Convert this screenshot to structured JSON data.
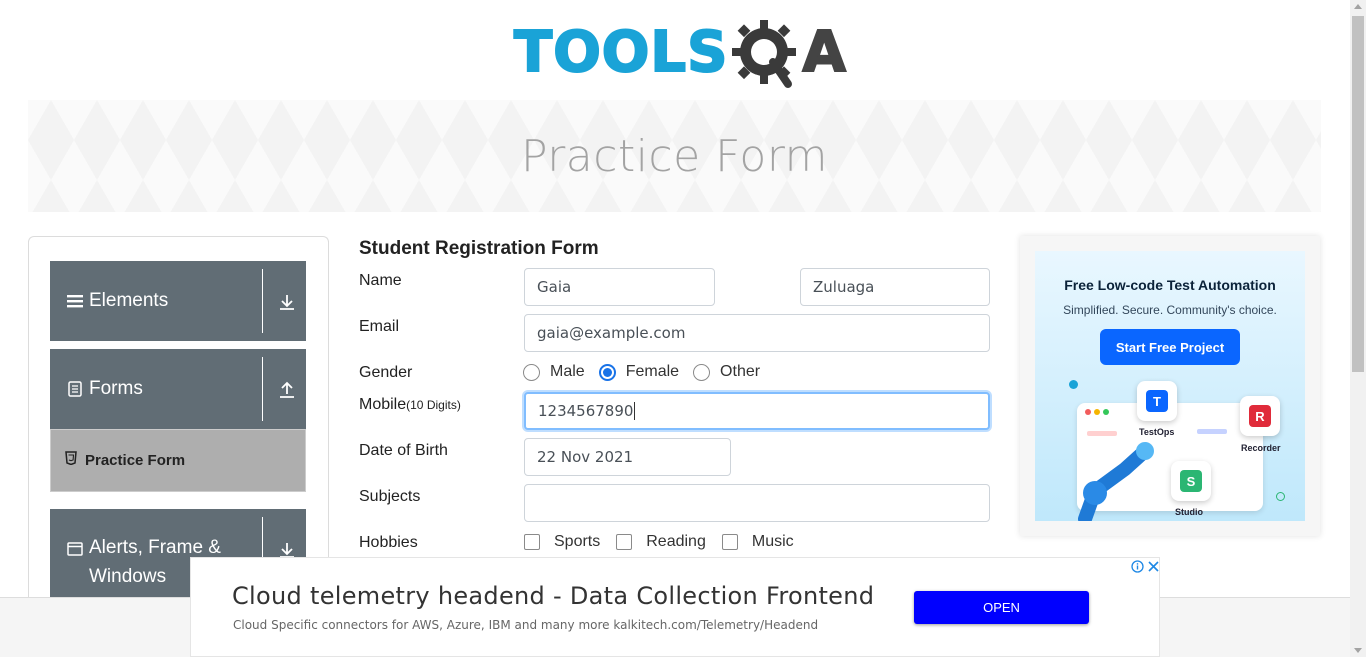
{
  "header": {
    "logo_tools": "TOOLS",
    "logo_a": "A",
    "logo_q": "Q"
  },
  "banner": {
    "title": "Practice Form"
  },
  "sidebar": {
    "groups": [
      {
        "label": "Elements",
        "icon": "hamburger-icon",
        "arrow": "download-arrow-icon"
      },
      {
        "label": "Forms",
        "icon": "document-icon",
        "arrow": "upload-arrow-icon",
        "items": [
          {
            "label": "Practice Form",
            "icon": "html5-icon"
          }
        ]
      },
      {
        "label": "Alerts, Frame & Windows",
        "icon": "window-icon",
        "arrow": "download-arrow-icon"
      }
    ]
  },
  "form": {
    "title": "Student Registration Form",
    "name_label": "Name",
    "first_name": "Gaia",
    "last_name": "Zuluaga",
    "email_label": "Email",
    "email_value": "gaia@example.com",
    "gender_label": "Gender",
    "gender_options": [
      "Male",
      "Female",
      "Other"
    ],
    "gender_selected": "Female",
    "mobile_label": "Mobile",
    "mobile_hint": "(10 Digits)",
    "mobile_value": "1234567890",
    "dob_label": "Date of Birth",
    "dob_value": "22 Nov 2021",
    "subjects_label": "Subjects",
    "hobbies_label": "Hobbies",
    "hobbies": [
      "Sports",
      "Reading",
      "Music"
    ]
  },
  "ad_right": {
    "headline": "Free Low-code Test Automation",
    "subline": "Simplified. Secure. Community's choice.",
    "button": "Start Free Project",
    "apps": [
      "TestOps",
      "Recorder",
      "Studio"
    ]
  },
  "ad_bottom": {
    "title": "Cloud telemetry headend - Data Collection Frontend",
    "subtitle": "Cloud Specific connectors for AWS, Azure, IBM and many more kalkitech.com/Telemetry/Headend",
    "button": "OPEN"
  },
  "colors": {
    "sidebar_bg": "#616d75",
    "brand_blue": "#1aa3d7",
    "radio_blue": "#1973e8",
    "open_button": "#0000ff"
  }
}
